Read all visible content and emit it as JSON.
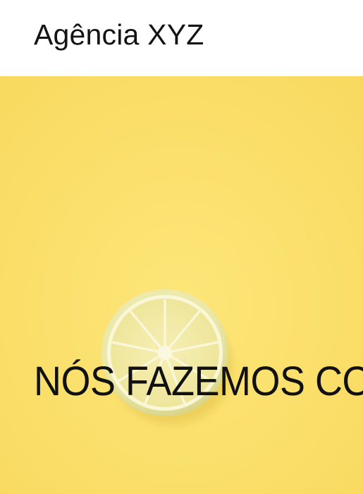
{
  "header": {
    "brand": "Agência XYZ"
  },
  "hero": {
    "headline": "NÓS FAZEMOS CO",
    "background_color": "#fbe26e",
    "image": "lemon-slice"
  }
}
